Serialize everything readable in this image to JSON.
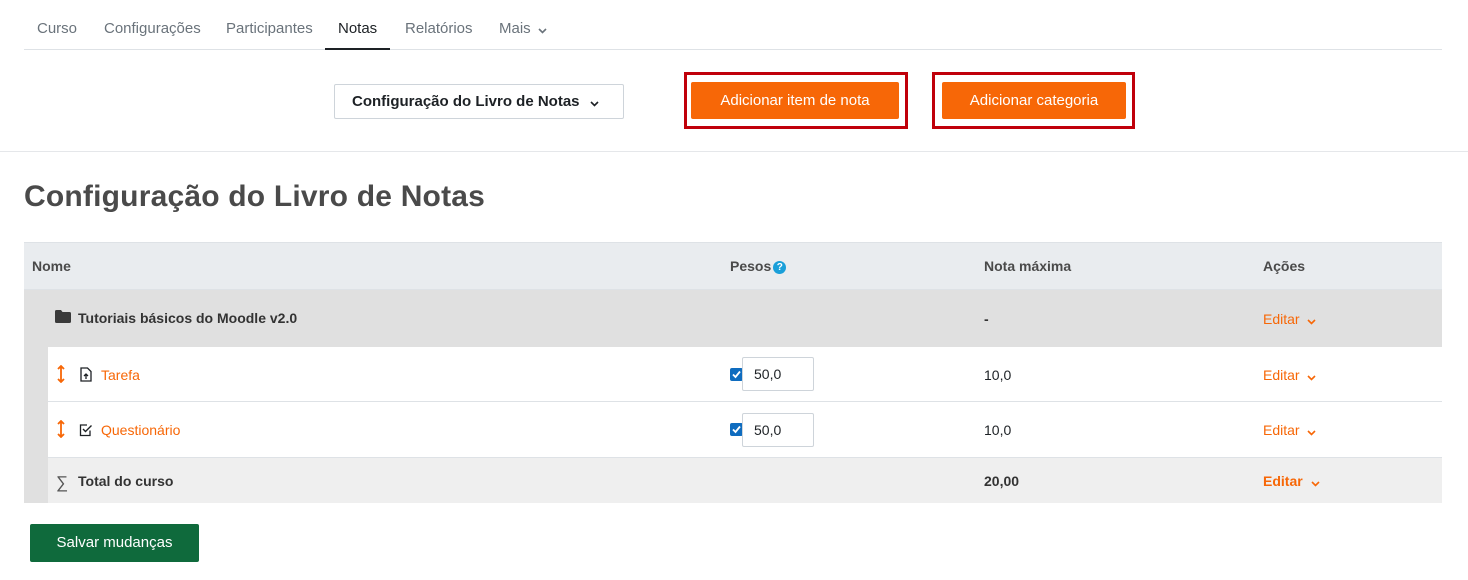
{
  "nav": {
    "tabs": [
      "Curso",
      "Configurações",
      "Participantes",
      "Notas",
      "Relatórios",
      "Mais"
    ],
    "active": "Notas"
  },
  "actionbar": {
    "dropdown_label": "Configuração do Livro de Notas",
    "add_item_label": "Adicionar item de nota",
    "add_category_label": "Adicionar categoria"
  },
  "page": {
    "title": "Configuração do Livro de Notas"
  },
  "table": {
    "headers": {
      "name": "Nome",
      "weights": "Pesos",
      "max_grade": "Nota máxima",
      "actions": "Ações"
    },
    "category": {
      "name": "Tutoriais básicos do Moodle v2.0",
      "max_grade": "-",
      "action": "Editar"
    },
    "items": [
      {
        "name": "Tarefa",
        "icon": "assignment-icon",
        "weight": "50,0",
        "weight_checked": true,
        "max_grade": "10,0",
        "action": "Editar"
      },
      {
        "name": "Questionário",
        "icon": "quiz-icon",
        "weight": "50,0",
        "weight_checked": true,
        "max_grade": "10,0",
        "action": "Editar"
      }
    ],
    "total": {
      "name": "Total do curso",
      "max_grade": "20,00",
      "action": "Editar"
    }
  },
  "footer": {
    "save_label": "Salvar mudanças"
  },
  "colors": {
    "accent": "#f76707",
    "save": "#0f6a3c",
    "highlight": "#c0000a",
    "checkbox": "#0f6cbf"
  }
}
